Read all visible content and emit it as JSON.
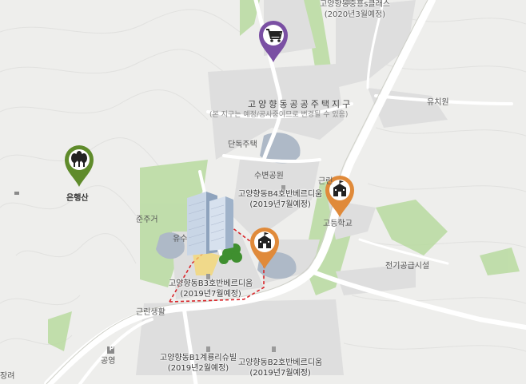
{
  "colors": {
    "purple": "#7a4fa3",
    "green": "#5f8b2b",
    "orange": "#e08a3a",
    "road": "#ffffff",
    "green_area": "#b9dba0",
    "water": "#aeb9c7",
    "building_block": "#dedede"
  },
  "pins": {
    "shopping": {
      "icon": "cart-icon",
      "color": "#7a4fa3"
    },
    "mountain": {
      "icon": "trees-icon",
      "color": "#5f8b2b",
      "label": "은행산"
    },
    "school_right": {
      "icon": "school-icon",
      "color": "#e08a3a",
      "label": "고등학교"
    },
    "school_center": {
      "icon": "school-icon",
      "color": "#e08a3a"
    }
  },
  "labels": {
    "top_complex": "고양향동중흥s클래스",
    "top_complex_date": "(2020년3월예정)",
    "district_title": "고양향동공공주택지구",
    "district_sub": "(본 지구는 예정/공사중이므로 변경될 수 있음)",
    "yuji": "유치원",
    "dandok": "단독주택",
    "subyeon": "수변공원",
    "b4": "고양향동B4호반베르디움",
    "b4_date": "(2019년7월예정)",
    "junju": "준주거",
    "yusu": "유수",
    "b3": "고양향동B3호반베르디움",
    "b3_date": "(2019년7월예정)",
    "geunrin": "근린생활",
    "gwan": "근린",
    "electric": "전기공급시설",
    "b1": "고양향동B1계룡리슈빌",
    "b1_date": "(2019년2월예정)",
    "b2": "고양향동B2호반베르디움",
    "b2_date": "(2019년7월예정)",
    "park_icon": "P",
    "gongyeong": "공영",
    "jangryeo": "장려"
  }
}
